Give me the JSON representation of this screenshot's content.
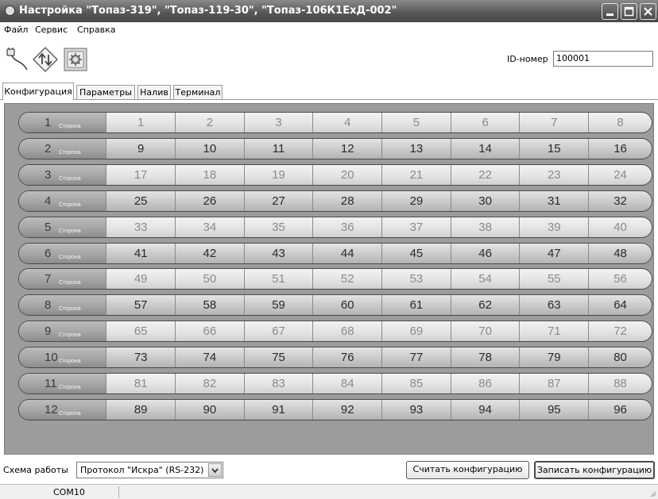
{
  "window": {
    "title": "Настройка \"Топаз-319\", \"Топаз-119-30\", \"Топаз-106К1ЕхД-002\""
  },
  "menu": [
    "Файл",
    "Сервис",
    "Справка"
  ],
  "toolbar": {
    "icons": [
      "connection-icon",
      "exchange-icon",
      "settings-icon"
    ],
    "id_label": "ID-номер",
    "id_value": "100001"
  },
  "tabs": [
    {
      "label": "Конфигурация",
      "active": true
    },
    {
      "label": "Параметры",
      "active": false
    },
    {
      "label": "Налив",
      "active": false
    },
    {
      "label": "Терминал",
      "active": false
    }
  ],
  "side_label": "Сторона",
  "rows": [
    {
      "side": "1",
      "values": [
        "1",
        "2",
        "3",
        "4",
        "5",
        "6",
        "7",
        "8"
      ],
      "active": false
    },
    {
      "side": "2",
      "values": [
        "9",
        "10",
        "11",
        "12",
        "13",
        "14",
        "15",
        "16"
      ],
      "active": true
    },
    {
      "side": "3",
      "values": [
        "17",
        "18",
        "19",
        "20",
        "21",
        "22",
        "23",
        "24"
      ],
      "active": false
    },
    {
      "side": "4",
      "values": [
        "25",
        "26",
        "27",
        "28",
        "29",
        "30",
        "31",
        "32"
      ],
      "active": true
    },
    {
      "side": "5",
      "values": [
        "33",
        "34",
        "35",
        "36",
        "37",
        "38",
        "39",
        "40"
      ],
      "active": false
    },
    {
      "side": "6",
      "values": [
        "41",
        "42",
        "43",
        "44",
        "45",
        "46",
        "47",
        "48"
      ],
      "active": true
    },
    {
      "side": "7",
      "values": [
        "49",
        "50",
        "51",
        "52",
        "53",
        "54",
        "55",
        "56"
      ],
      "active": false
    },
    {
      "side": "8",
      "values": [
        "57",
        "58",
        "59",
        "60",
        "61",
        "62",
        "63",
        "64"
      ],
      "active": true
    },
    {
      "side": "9",
      "values": [
        "65",
        "66",
        "67",
        "68",
        "69",
        "70",
        "71",
        "72"
      ],
      "active": false
    },
    {
      "side": "10",
      "values": [
        "73",
        "74",
        "75",
        "76",
        "77",
        "78",
        "79",
        "80"
      ],
      "active": true
    },
    {
      "side": "11",
      "values": [
        "81",
        "82",
        "83",
        "84",
        "85",
        "86",
        "87",
        "88"
      ],
      "active": false
    },
    {
      "side": "12",
      "values": [
        "89",
        "90",
        "91",
        "92",
        "93",
        "94",
        "95",
        "96"
      ],
      "active": true
    }
  ],
  "bottom": {
    "scheme_label": "Схема работы",
    "scheme_value": "Протокол \"Искра\" (RS-232)",
    "read_button": "Считать конфигурацию",
    "write_button": "Записать конфигурацию"
  },
  "status": {
    "port": "COM10"
  }
}
